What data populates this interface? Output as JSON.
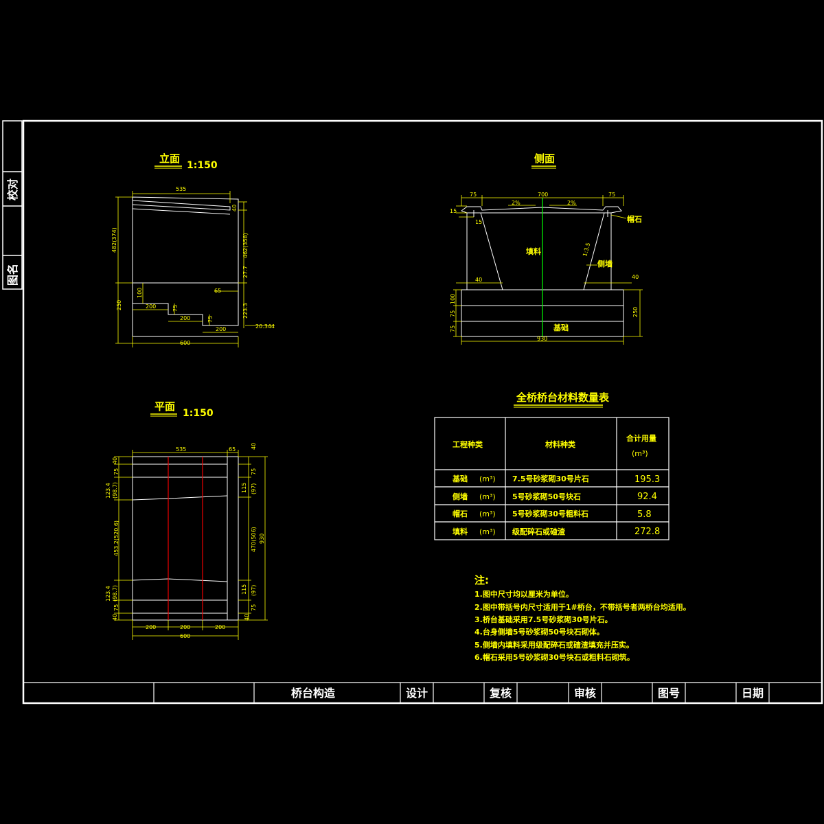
{
  "side_panel": {
    "check": "校对",
    "drawing_name": "图名"
  },
  "elevation": {
    "title": "立面",
    "scale": "1:150",
    "dims": {
      "top": "535",
      "left_height": "482(374)",
      "right_height": "462(358)",
      "cap_right": "40",
      "small_right": "27.7",
      "d65": "65",
      "d100": "100",
      "d250": "250",
      "step1": "200",
      "step2": "200",
      "step3": "200",
      "s75a": "75",
      "s75b": "75",
      "h2233": "223.3",
      "elev": "20.344",
      "total": "600"
    }
  },
  "side": {
    "title": "侧面",
    "dims": {
      "left_top": "75",
      "mid_top": "700",
      "right_top": "75",
      "slope_left": "2%",
      "slope_right": "2%",
      "d15a": "15",
      "d15b": "15",
      "d40l": "40",
      "d40r": "40",
      "d100": "100",
      "d75a": "75",
      "d75b": "75",
      "d250": "250",
      "total": "930",
      "batter": "1:3.5"
    },
    "labels": {
      "fill": "填料",
      "cap": "帽石",
      "wall": "侧墙",
      "found": "基础"
    }
  },
  "plan": {
    "title": "平面",
    "scale": "1:150",
    "dims": {
      "top": "535",
      "top_right": "65",
      "r40a": "40",
      "r75a": "75",
      "r115a": "115",
      "r97a": "(97)",
      "r470": "470(506)",
      "r930": "930",
      "r115b": "115",
      "r97b": "(97)",
      "r75b": "75",
      "r40b": "40",
      "l40a": "40",
      "l75a": "75",
      "l1234a": "123.4",
      "l987a": "(98.7)",
      "l4532": "453.2(520.6)",
      "l1234b": "123.4",
      "l987b": "(98.7)",
      "l75b": "75",
      "l40b": "40",
      "b200a": "200",
      "b200b": "200",
      "b200c": "200",
      "total": "600"
    }
  },
  "table": {
    "title": "全桥桥台材料数量表",
    "headers": {
      "item": "工程种类",
      "material": "材料种类",
      "total": "合计用量",
      "unit": "(m³)"
    },
    "rows": [
      {
        "item": "基础",
        "unit": "(m³)",
        "material": "7.5号砂浆砌30号片石",
        "amount": "195.3"
      },
      {
        "item": "侧墙",
        "unit": "(m³)",
        "material": "5号砂浆砌50号块石",
        "amount": "92.4"
      },
      {
        "item": "帽石",
        "unit": "(m³)",
        "material": "5号砂浆砌30号粗料石",
        "amount": "5.8"
      },
      {
        "item": "填料",
        "unit": "(m³)",
        "material": "级配碎石或碴渣",
        "amount": "272.8"
      }
    ]
  },
  "notes": {
    "title": "注:",
    "items": [
      "1.图中尺寸均以厘米为单位。",
      "2.图中带括号内尺寸适用于1#桥台，不带括号者两桥台均适用。",
      "3.桥台基础采用7.5号砂浆砌30号片石。",
      "4.台身侧墙5号砂浆砌50号块石砌体。",
      "5.侧墙内填料采用级配碎石或碴渣填充并压实。",
      "6.帽石采用5号砂浆砌30号块石或粗料石砌筑。"
    ]
  },
  "title_block": {
    "name": "桥台构造",
    "design": "设计",
    "review": "复核",
    "approve": "审核",
    "drawing_no": "图号",
    "date": "日期"
  }
}
